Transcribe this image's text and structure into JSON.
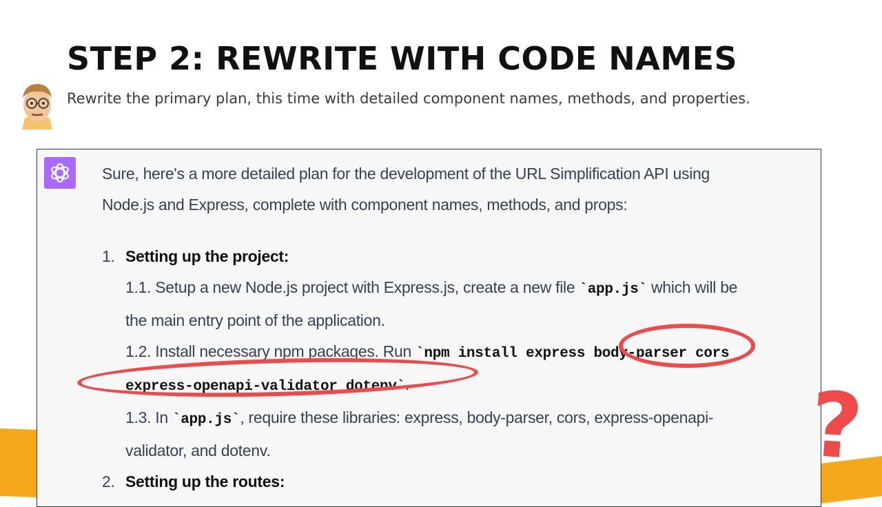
{
  "slide": {
    "title": "STEP 2: REWRITE WITH CODE NAMES",
    "subtitle": "Rewrite the primary plan, this time with detailed component names, methods, and properties."
  },
  "chat": {
    "intro_line1": "Sure, here's a more detailed plan for the development of the URL Simplification API using",
    "intro_line2": "Node.js and Express, complete with component names, methods, and props:",
    "items": [
      {
        "num": "1.",
        "title": "Setting up the project:",
        "s1_a": "1.1. Setup a new Node.js project with Express.js, create a new file ",
        "s1_code": "`app.js`",
        "s1_b": " which will be",
        "s1_line2": "the main entry point of the application.",
        "s2_a": "1.2. Install necessary npm packages. Run ",
        "s2_code1": "`npm install express body-parser cors",
        "s2_code2": "express-openapi-validator dotenv`",
        "s2_b": ".",
        "s3_a": "1.3. In ",
        "s3_code": "`app.js`",
        "s3_b": ", require these libraries: express, body-parser, cors, express-openapi-",
        "s3_line2": "validator, and dotenv."
      },
      {
        "num": "2.",
        "title": "Setting up the routes:"
      }
    ]
  },
  "annotations": {
    "question_mark": "?",
    "highlight_color": "#ee4a4a",
    "accent_color": "#f5a81c",
    "assistant_icon_color": "#ab68ff"
  }
}
